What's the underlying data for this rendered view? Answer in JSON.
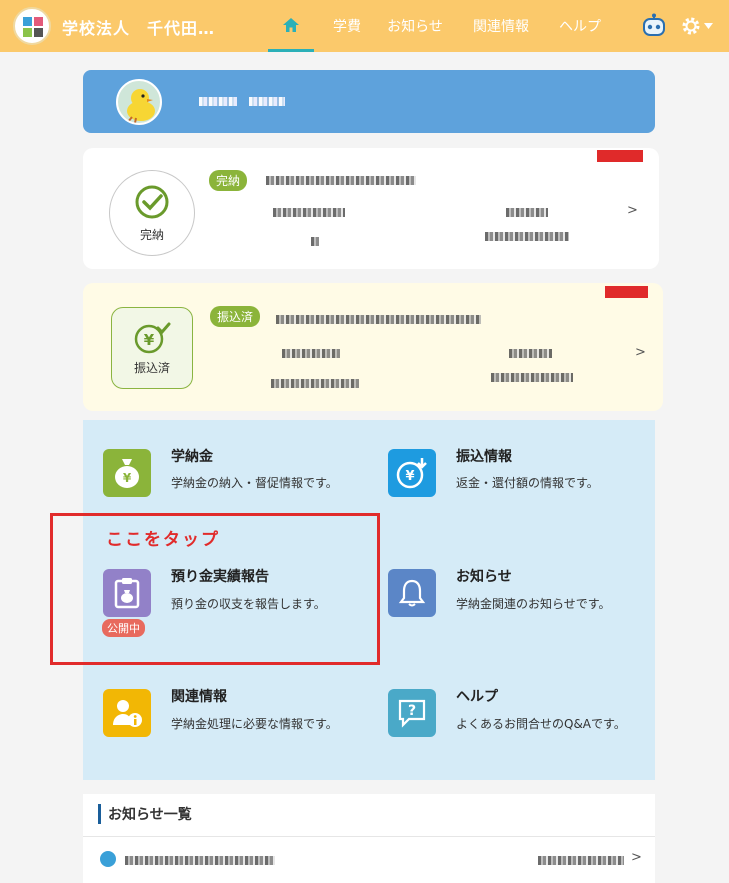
{
  "header": {
    "brand": "学校法人　千代田…",
    "nav": [
      {
        "label": "学費"
      },
      {
        "label": "お知らせ"
      },
      {
        "label": "関連情報"
      },
      {
        "label": "ヘルプ"
      }
    ],
    "icons": {
      "home": "home-icon",
      "bot": "robot-icon",
      "settings": "gear-icon"
    }
  },
  "status_cards": [
    {
      "status_label": "完納",
      "pill": "完納",
      "icon": "check-circle-icon",
      "bg": "#ffffff"
    },
    {
      "status_label": "振込済",
      "pill": "振込済",
      "icon": "yen-check-icon",
      "bg": "#fffbe6"
    }
  ],
  "menu": {
    "items": [
      {
        "title": "学納金",
        "desc": "学納金の納入・督促情報です。",
        "icon": "money-bag-icon",
        "color": "#8bb43a"
      },
      {
        "title": "振込情報",
        "desc": "返金・還付額の情報です。",
        "icon": "yen-transfer-icon",
        "color": "#1e9be0"
      },
      {
        "title": "預り金実績報告",
        "desc": "預り金の収支を報告します。",
        "icon": "clipboard-icon",
        "color": "#9281c8",
        "badge": "公開中"
      },
      {
        "title": "お知らせ",
        "desc": "学納金関連のお知らせです。",
        "icon": "bell-icon",
        "color": "#5b86c7"
      },
      {
        "title": "関連情報",
        "desc": "学納金処理に必要な情報です。",
        "icon": "user-info-icon",
        "color": "#f2b705"
      },
      {
        "title": "ヘルプ",
        "desc": "よくあるお問合せのQ&Aです。",
        "icon": "question-bubble-icon",
        "color": "#4aa9c8"
      }
    ]
  },
  "annotation": {
    "tap_text": "ここをタップ"
  },
  "news": {
    "title": "お知らせ一覧"
  },
  "colors": {
    "header": "#fbc96b",
    "accent": "#2bb0b8",
    "banner": "#5ea2dc",
    "annotation": "#e12b2b"
  }
}
